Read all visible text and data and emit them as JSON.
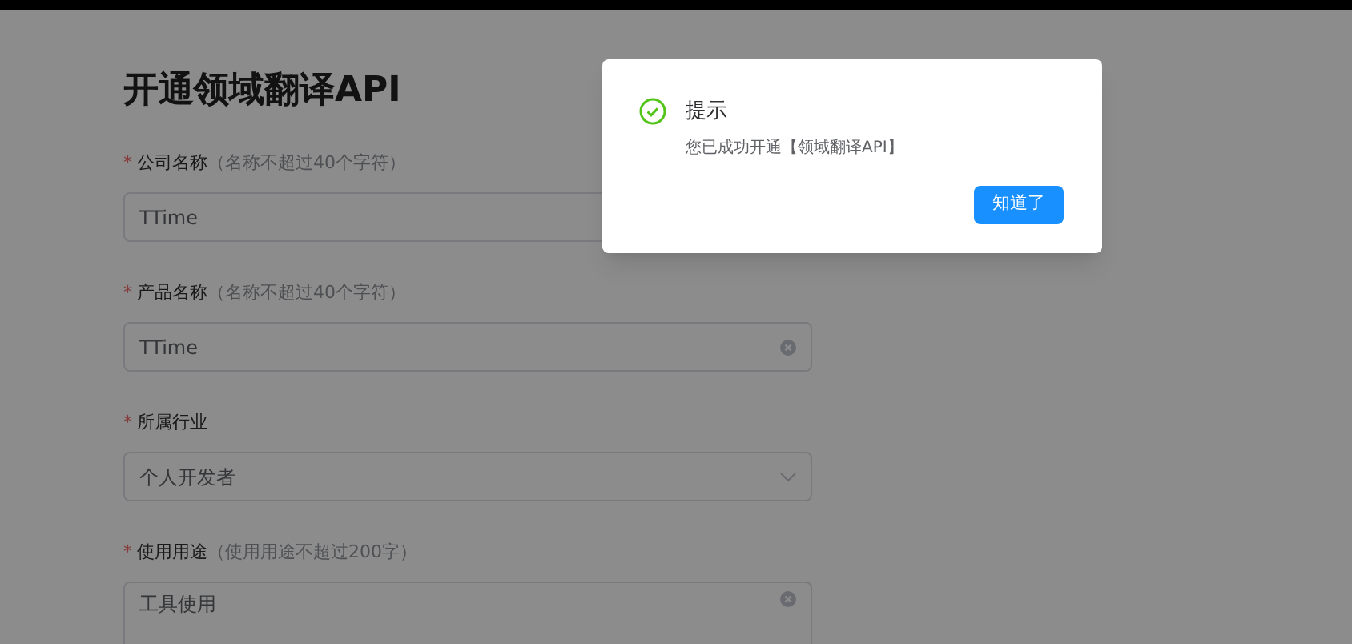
{
  "page_title": "开通领域翻译API",
  "fields": [
    {
      "kind": "input",
      "label": "公司名称",
      "hint": "（名称不超过40个字符）",
      "required_mark": "*",
      "value": "TTime",
      "clear_icon": false
    },
    {
      "kind": "input",
      "label": "产品名称",
      "hint": "（名称不超过40个字符）",
      "required_mark": "*",
      "value": "TTime",
      "clear_icon": true
    },
    {
      "kind": "select",
      "label": "所属行业",
      "required_mark": "*",
      "value": "个人开发者",
      "clear_icon": false
    },
    {
      "kind": "textarea",
      "label": "使用用途",
      "hint": "（使用用途不超过200字）",
      "required_mark": "*",
      "value": "工具使用",
      "clear_icon": true
    }
  ],
  "dialog": {
    "title": "提示",
    "message": "您已成功开通【领域翻译API】",
    "button": "知道了"
  }
}
